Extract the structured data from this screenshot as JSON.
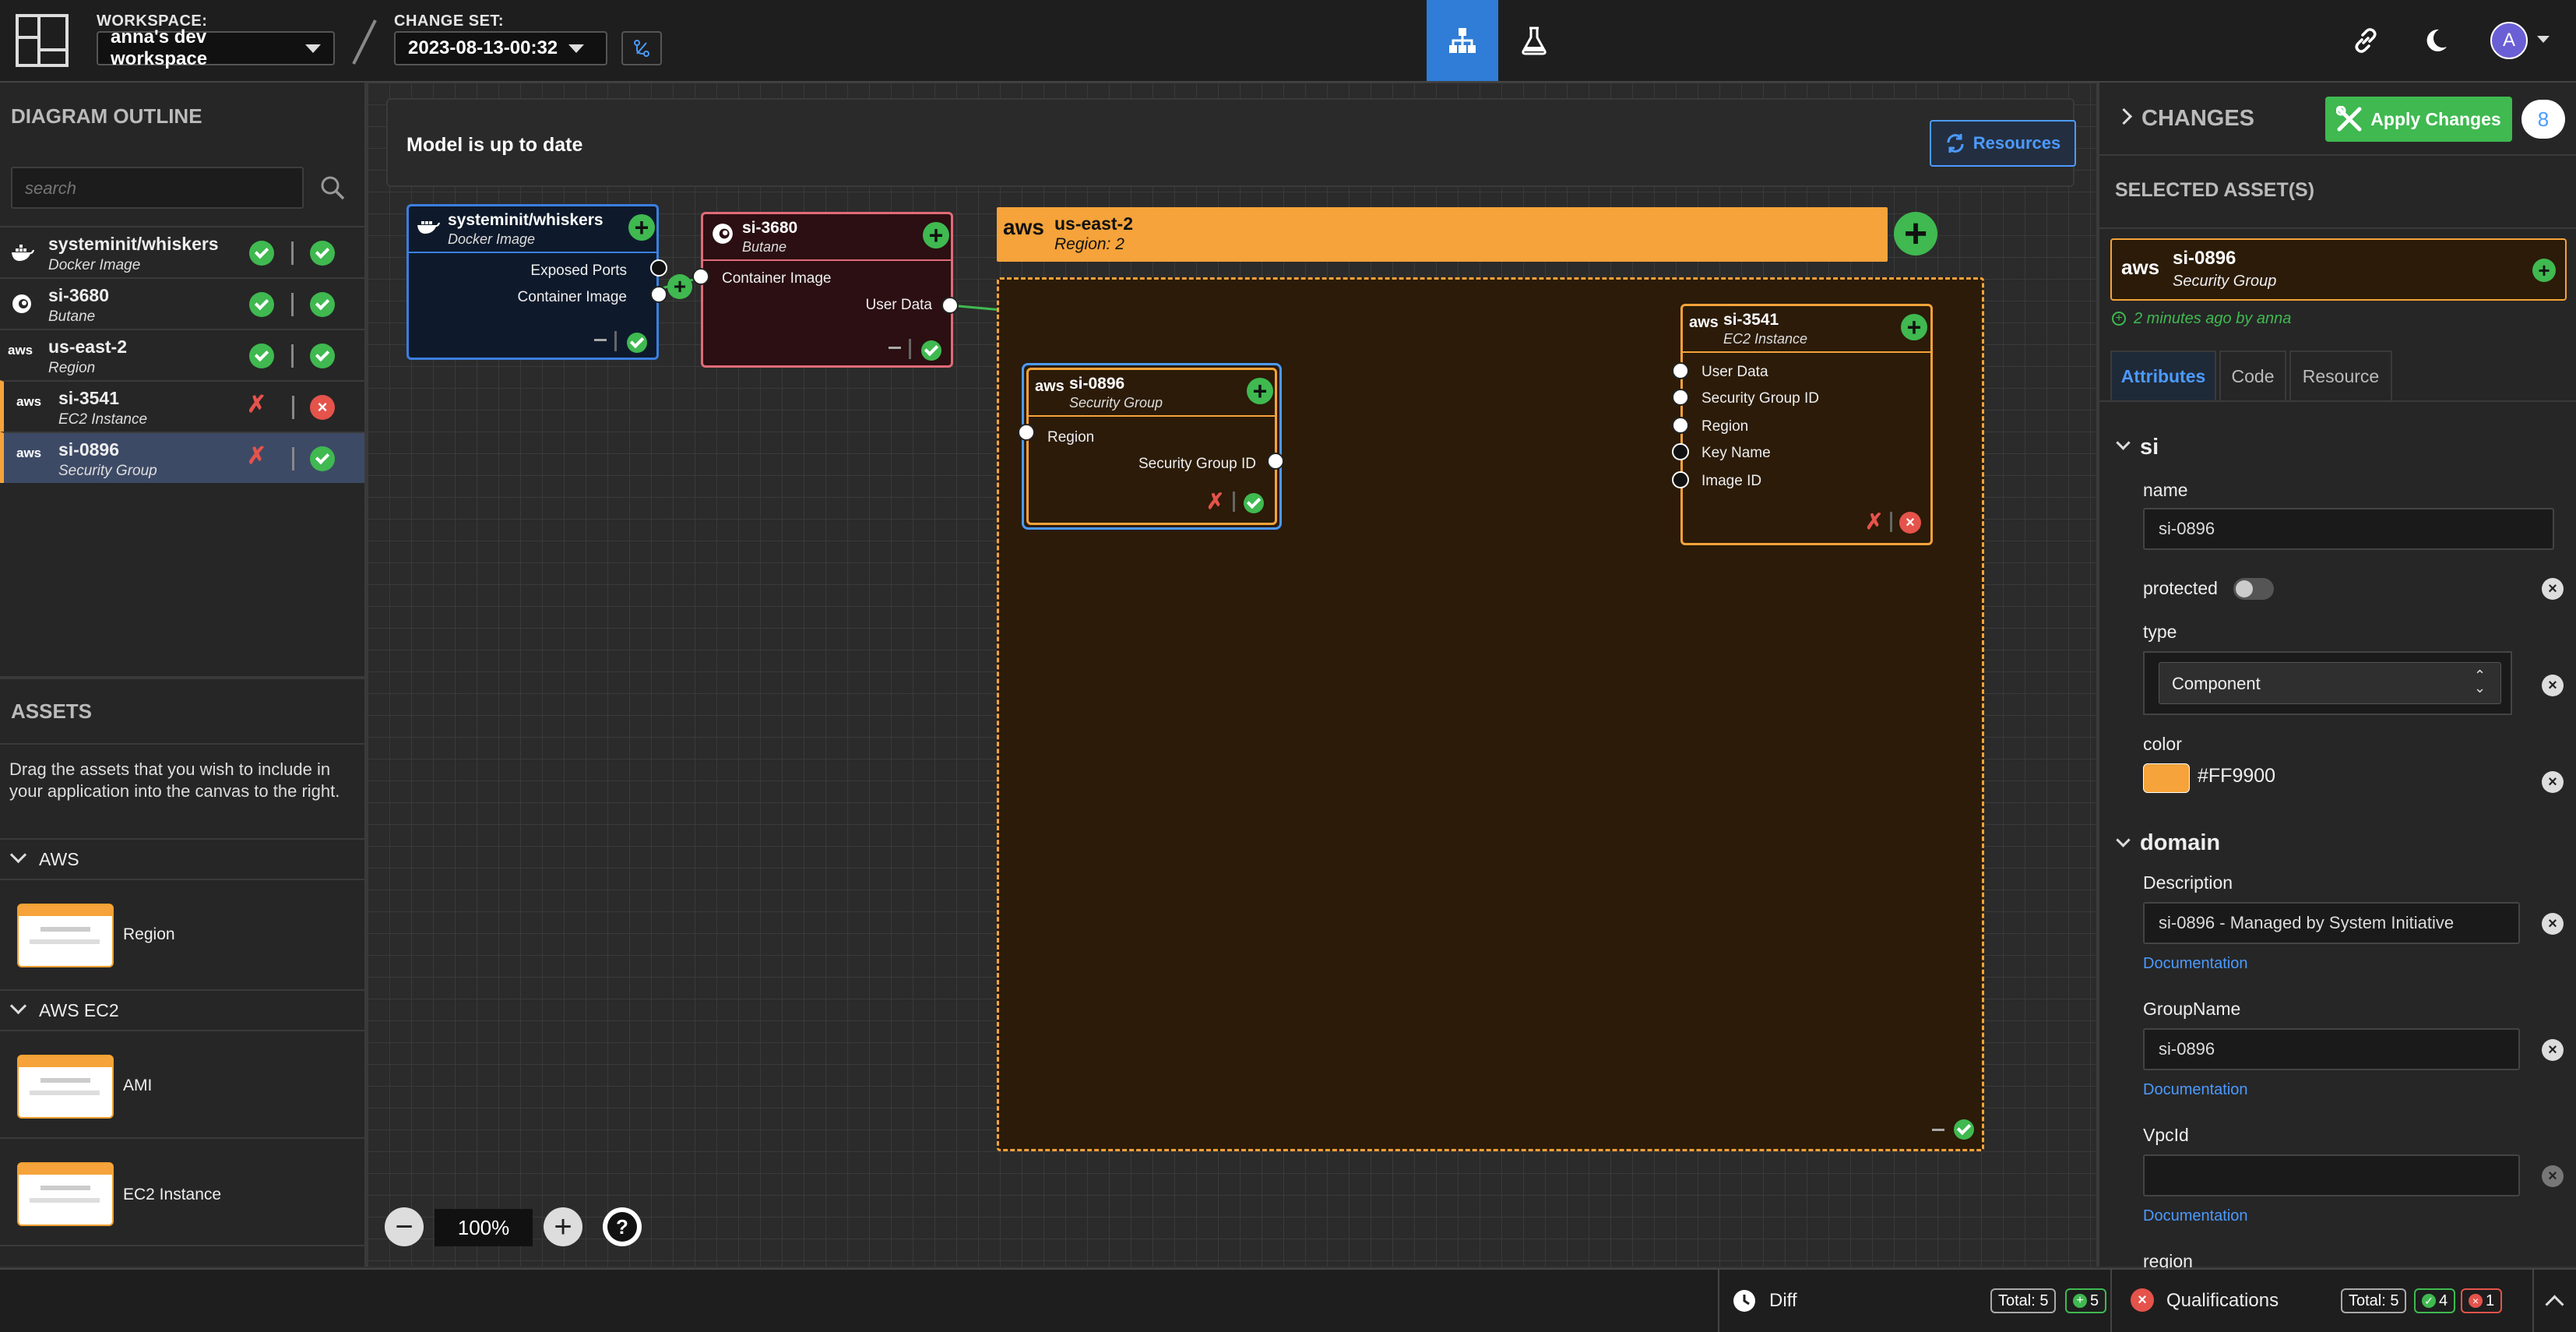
{
  "topbar": {
    "workspace_label": "WORKSPACE:",
    "workspace_value": "anna's dev workspace",
    "changeset_label": "CHANGE SET:",
    "changeset_value": "2023-08-13-00:32",
    "avatar_initial": "A"
  },
  "outline": {
    "title": "DIAGRAM OUTLINE",
    "search_placeholder": "search",
    "items": [
      {
        "name": "systeminit/whiskers",
        "type": "Docker Image"
      },
      {
        "name": "si-3680",
        "type": "Butane"
      },
      {
        "name": "us-east-2",
        "type": "Region"
      },
      {
        "name": "si-3541",
        "type": "EC2 Instance"
      },
      {
        "name": "si-0896",
        "type": "Security Group"
      }
    ]
  },
  "assets": {
    "title": "ASSETS",
    "hint": "Drag the assets that you wish to include in your application into the canvas to the right.",
    "groups": [
      {
        "name": "AWS",
        "items": [
          "Region"
        ]
      },
      {
        "name": "AWS EC2",
        "items": [
          "AMI",
          "EC2 Instance"
        ]
      }
    ]
  },
  "canvas": {
    "status": "Model is up to date",
    "resources_button": "Resources",
    "zoom": "100%",
    "nodes": {
      "whiskers": {
        "name": "systeminit/whiskers",
        "type": "Docker Image",
        "ports": [
          "Exposed Ports",
          "Container Image"
        ]
      },
      "butane": {
        "name": "si-3680",
        "type": "Butane",
        "ports": [
          "Container Image",
          "User Data"
        ]
      },
      "region": {
        "name": "us-east-2",
        "type": "Region: 2"
      },
      "sg": {
        "name": "si-0896",
        "type": "Security Group",
        "ports": [
          "Region",
          "Security Group ID"
        ]
      },
      "ec2": {
        "name": "si-3541",
        "type": "EC2 Instance",
        "ports": [
          "User Data",
          "Security Group ID",
          "Region",
          "Key Name",
          "Image ID"
        ]
      }
    },
    "aws_logo": "aws"
  },
  "changes": {
    "title": "CHANGES",
    "apply_button": "Apply Changes",
    "count": "8",
    "selected_title": "SELECTED ASSET(S)",
    "selected_name": "si-0896",
    "selected_type": "Security Group",
    "updated": "2 minutes ago by anna",
    "tabs": [
      "Attributes",
      "Code",
      "Resource"
    ],
    "si_section": "si",
    "name_label": "name",
    "name_value": "si-0896",
    "protected_label": "protected",
    "type_label": "type",
    "type_value": "Component",
    "color_label": "color",
    "color_value": "#FF9900",
    "domain_section": "domain",
    "description_label": "Description",
    "description_value": "si-0896 - Managed by System Initiative",
    "groupname_label": "GroupName",
    "groupname_value": "si-0896",
    "vpcid_label": "VpcId",
    "vpcid_value": "",
    "region_label": "region",
    "doc_link": "Documentation"
  },
  "bottom": {
    "diff_label": "Diff",
    "diff_total": "Total: 5",
    "diff_added": "5",
    "qual_label": "Qualifications",
    "qual_total": "Total: 5",
    "qual_ok": "4",
    "qual_fail": "1"
  },
  "colors": {
    "accent_orange": "#FF9900",
    "success": "#3fb950",
    "error": "#e5534b",
    "link": "#4c9aff"
  }
}
